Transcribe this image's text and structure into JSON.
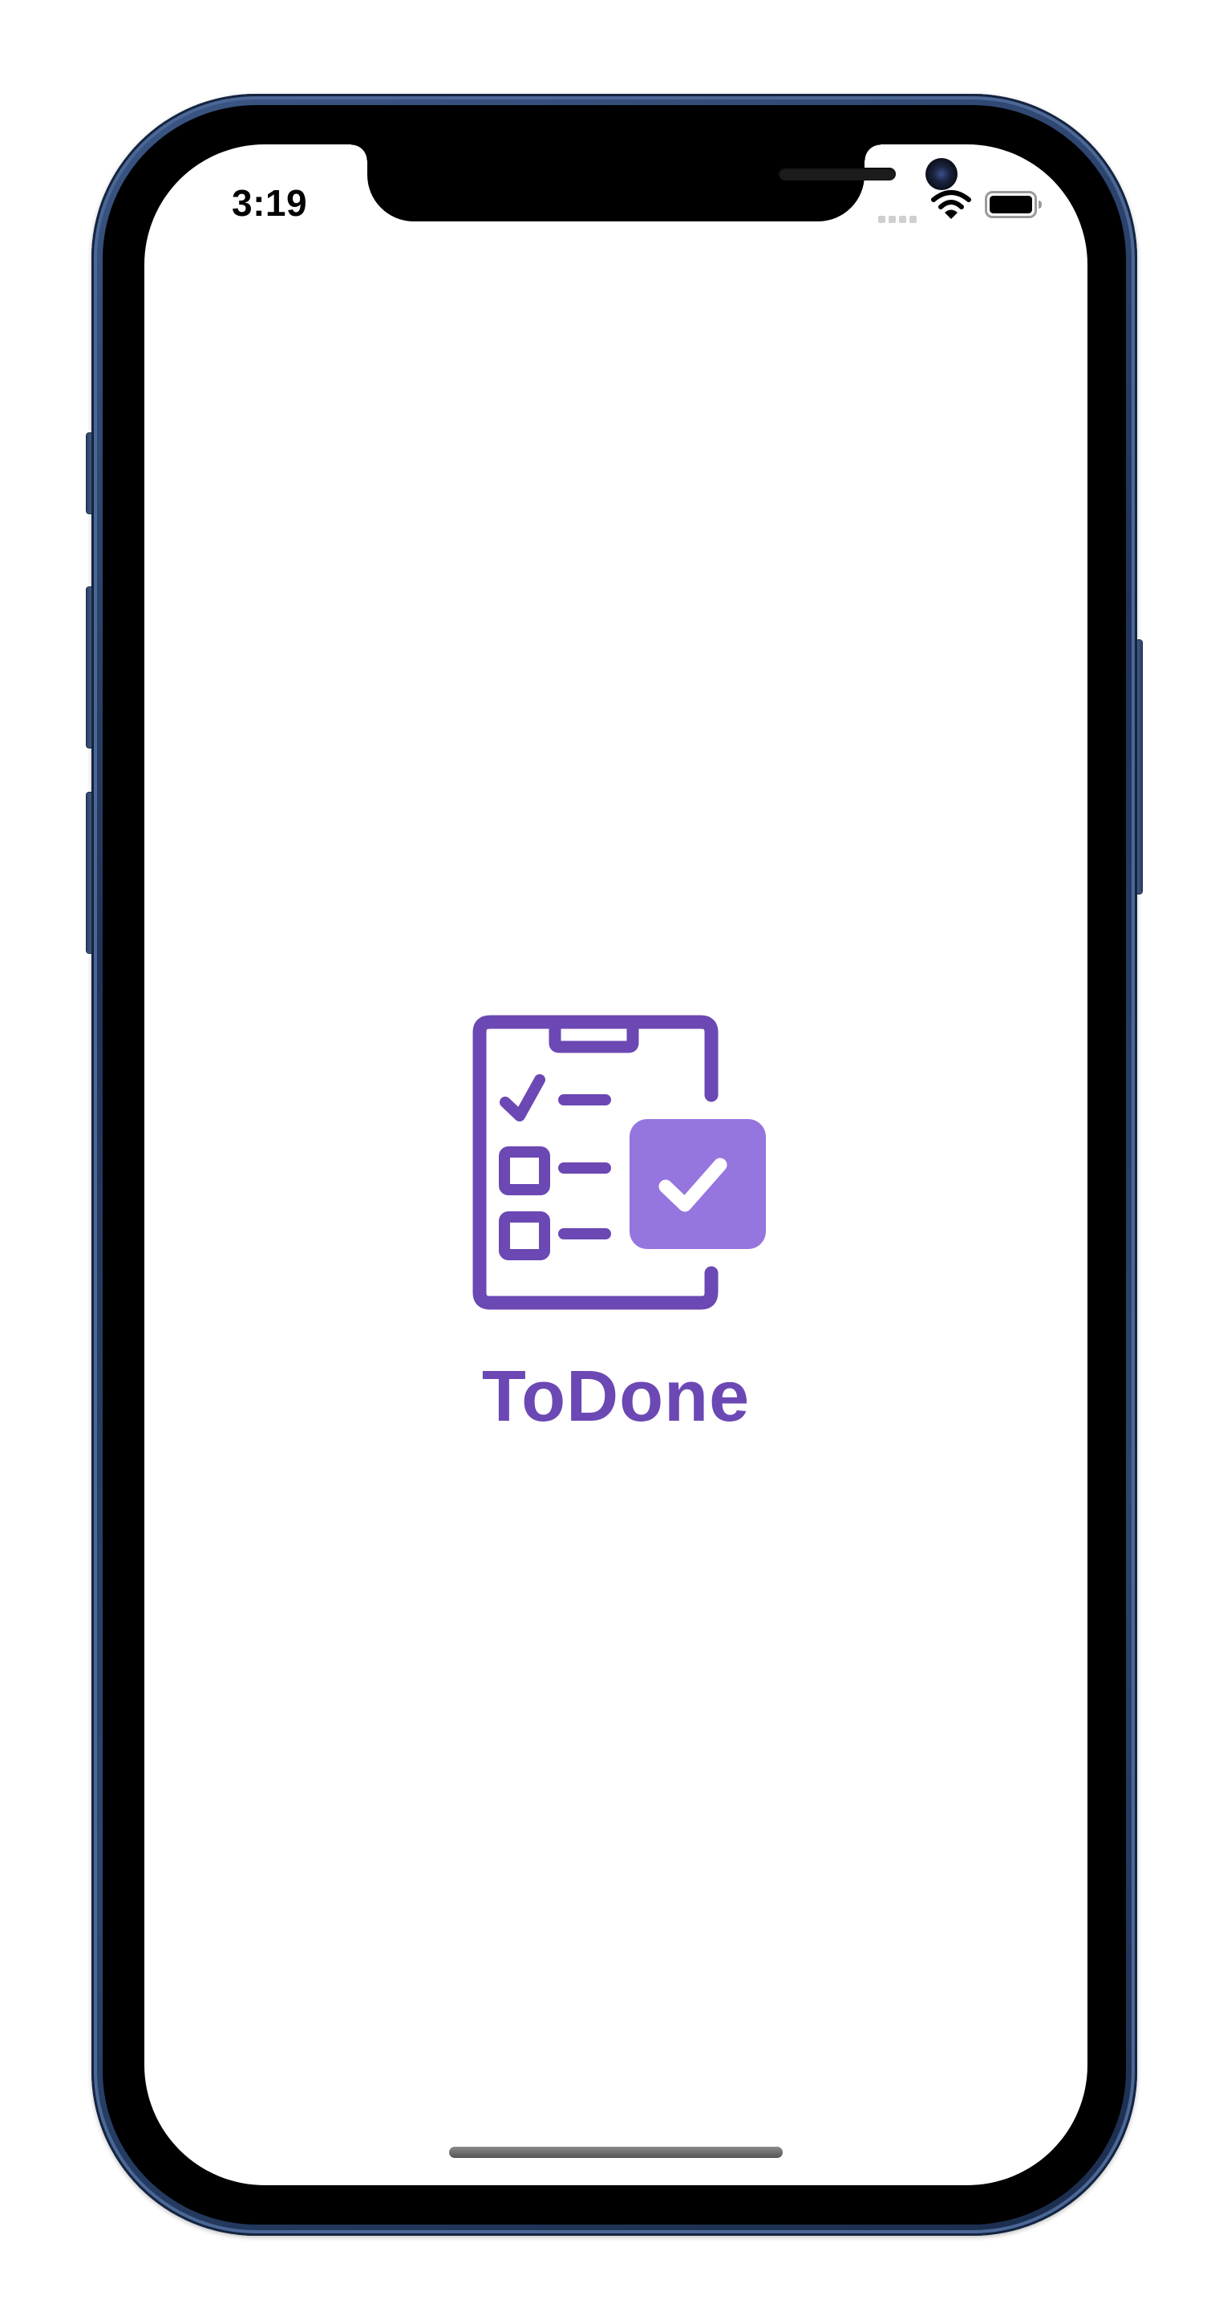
{
  "status_bar": {
    "time": "3:19",
    "icons": [
      "cellular-signal-icon",
      "wifi-icon",
      "battery-icon"
    ]
  },
  "splash": {
    "logo_icon": "clipboard-checklist-icon",
    "app_name": "ToDone"
  },
  "colors": {
    "brand_primary": "#6b48b3",
    "brand_accent": "#9575de",
    "background": "#ffffff",
    "device_frame": "#1f3358"
  }
}
